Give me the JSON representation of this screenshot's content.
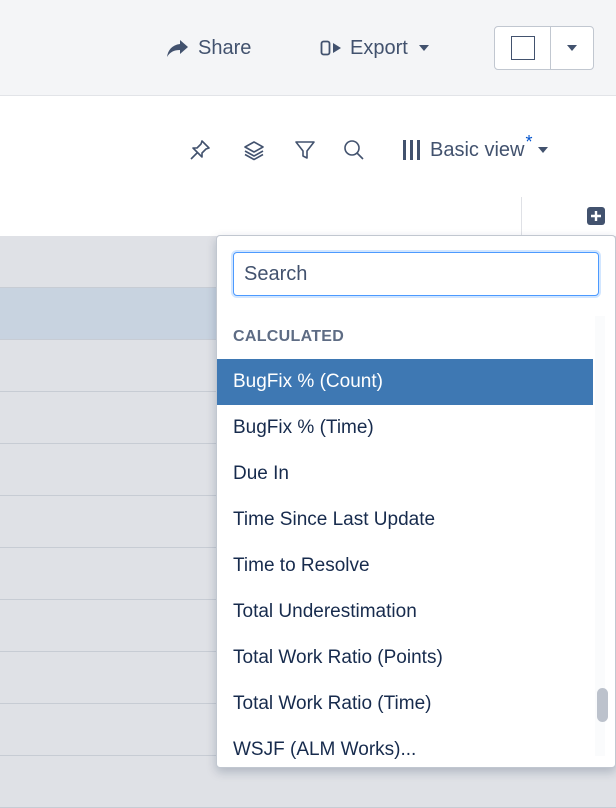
{
  "header": {
    "share_label": "Share",
    "export_label": "Export"
  },
  "toolbar": {
    "basic_view_label": "Basic view",
    "modified_marker": "*"
  },
  "dropdown": {
    "search_placeholder": "Search",
    "search_value": "",
    "section_label": "CALCULATED",
    "items": [
      {
        "label": "BugFix % (Count)",
        "highlighted": true
      },
      {
        "label": "BugFix % (Time)"
      },
      {
        "label": "Due In"
      },
      {
        "label": "Time Since Last Update"
      },
      {
        "label": "Time to Resolve"
      },
      {
        "label": "Total Underestimation"
      },
      {
        "label": "Total Work Ratio (Points)"
      },
      {
        "label": "Total Work Ratio (Time)"
      },
      {
        "label": "WSJF (ALM Works)..."
      }
    ]
  },
  "colors": {
    "highlight": "#3e78b3",
    "selected_row": "#c8d3e0",
    "accent": "#0052cc"
  }
}
